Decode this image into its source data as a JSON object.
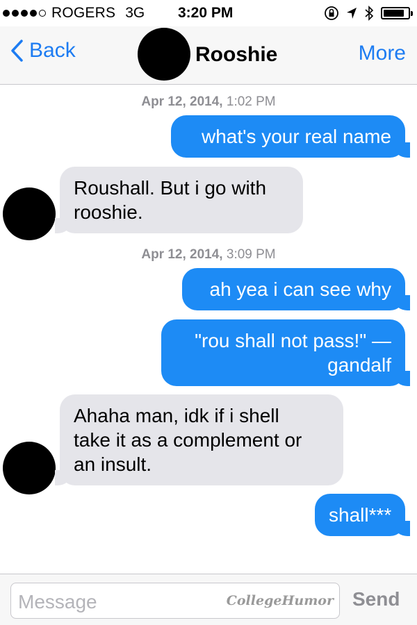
{
  "status_bar": {
    "carrier": "ROGERS",
    "network": "3G",
    "time": "3:20 PM",
    "signal_bars_filled": 4,
    "signal_bars_total": 5,
    "battery_level": 0.85,
    "icons": [
      "lock-rotation-icon",
      "location-arrow-icon",
      "bluetooth-icon",
      "battery-icon"
    ]
  },
  "nav": {
    "back_label": "Back",
    "contact_name": "Rooshie",
    "more_label": "More"
  },
  "conversation": {
    "timestamps": [
      {
        "date": "Apr 12, 2014,",
        "time": "1:02 PM"
      },
      {
        "date": "Apr 12, 2014,",
        "time": "3:09 PM"
      }
    ],
    "messages": [
      {
        "direction": "sent",
        "lines": [
          "what's your real name"
        ]
      },
      {
        "direction": "received",
        "lines": [
          "Roushall. But i go with",
          "rooshie."
        ]
      },
      {
        "direction": "sent",
        "lines": [
          "ah yea i can see why"
        ]
      },
      {
        "direction": "sent",
        "lines": [
          "\"rou shall not pass!\" —",
          "gandalf"
        ]
      },
      {
        "direction": "received",
        "lines": [
          "Ahaha man, idk if i shell",
          "take it as a complement or",
          "an insult."
        ]
      },
      {
        "direction": "sent",
        "lines": [
          "shall***"
        ]
      }
    ]
  },
  "composer": {
    "placeholder": "Message",
    "watermark": "CollegeHumor",
    "send_label": "Send"
  },
  "colors": {
    "accent": "#1d7cf2",
    "sent_bubble": "#1d8bf5",
    "received_bubble": "#e5e5ea"
  }
}
